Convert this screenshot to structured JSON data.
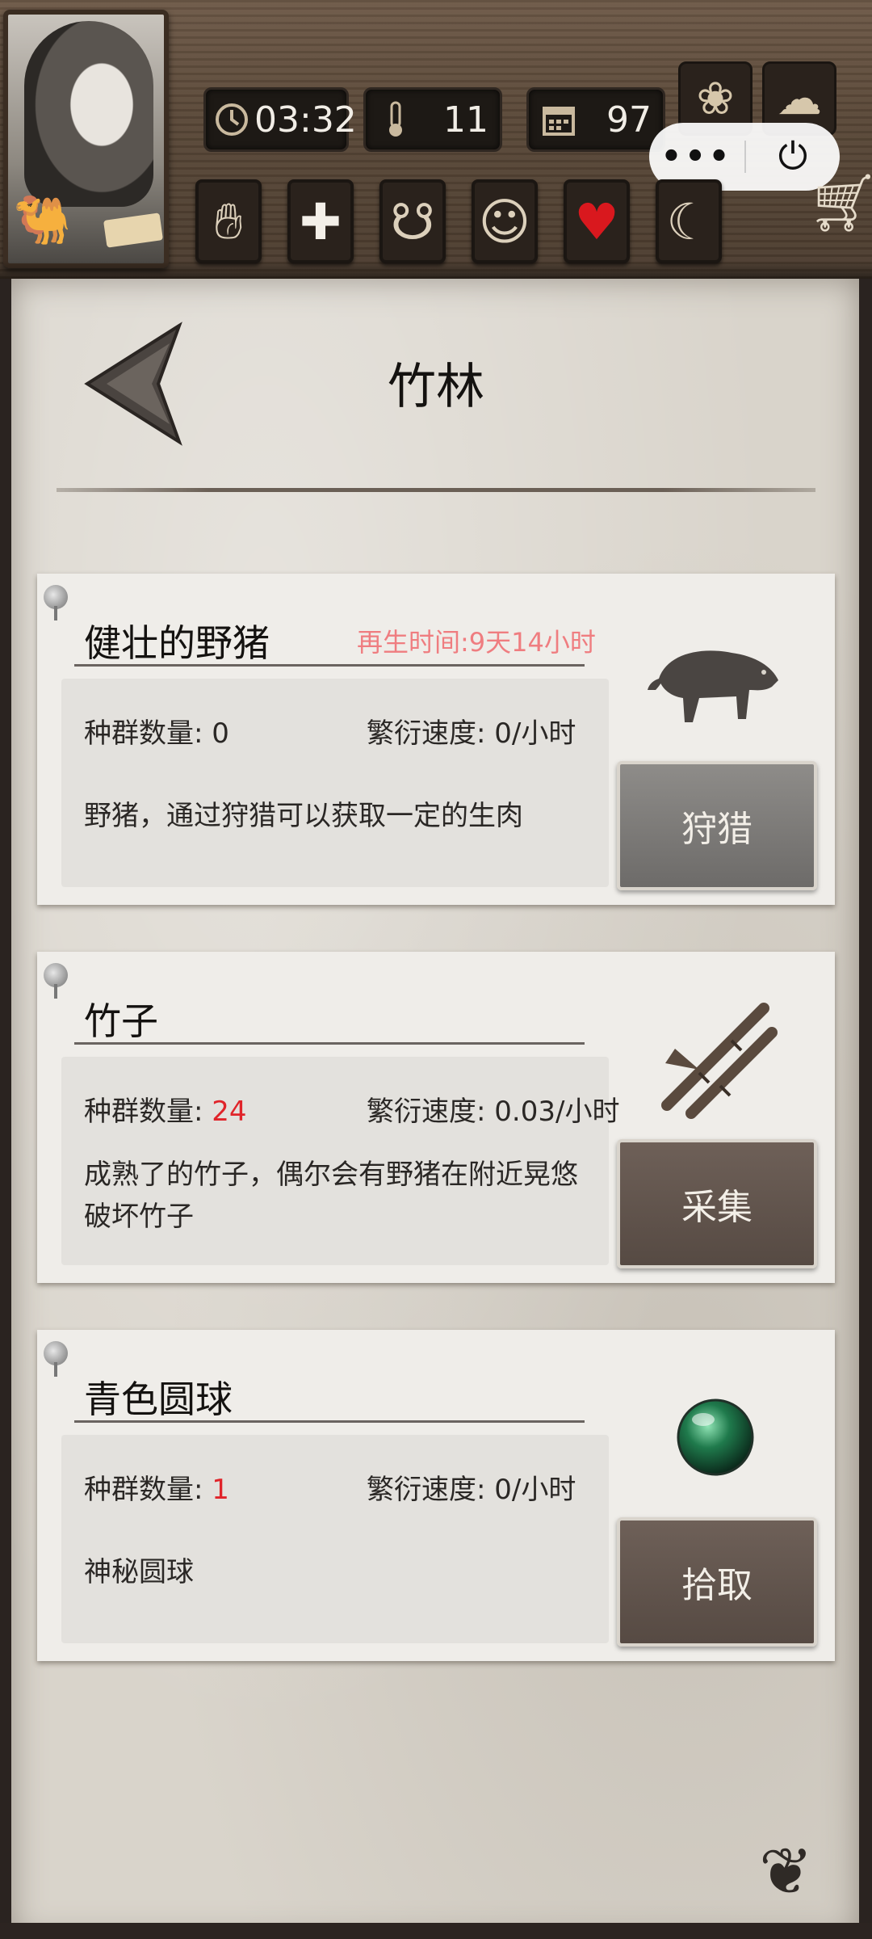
{
  "hud": {
    "time": "03:32",
    "temperature": "11",
    "day": "97",
    "attributes": [
      "hand-icon",
      "cross-icon",
      "stomach-icon",
      "brain-icon",
      "heart-icon",
      "moon-icon"
    ]
  },
  "page": {
    "title": "竹林"
  },
  "resources": [
    {
      "name": "健壮的野猪",
      "regen": "再生时间:9天14小时",
      "population_label": "种群数量:",
      "population": "0",
      "rate_label": "繁衍速度:",
      "rate": "0/小时",
      "description": "野猪，通过狩猎可以获取一定的生肉",
      "action": "狩猎",
      "icon": "boar-icon"
    },
    {
      "name": "竹子",
      "regen": "",
      "population_label": "种群数量:",
      "population": "24",
      "rate_label": "繁衍速度:",
      "rate": "0.03/小时",
      "description": "成熟了的竹子，偶尔会有野猪在附近晃悠破坏竹子",
      "action": "采集",
      "icon": "bamboo-icon"
    },
    {
      "name": "青色圆球",
      "regen": "",
      "population_label": "种群数量:",
      "population": "1",
      "rate_label": "繁衍速度:",
      "rate": "0/小时",
      "description": "神秘圆球",
      "action": "拾取",
      "icon": "orb-icon"
    }
  ],
  "colors": {
    "accent_red": "#e0242a",
    "regen_pink": "#ef7d80",
    "parchment": "#d9d4cb"
  }
}
